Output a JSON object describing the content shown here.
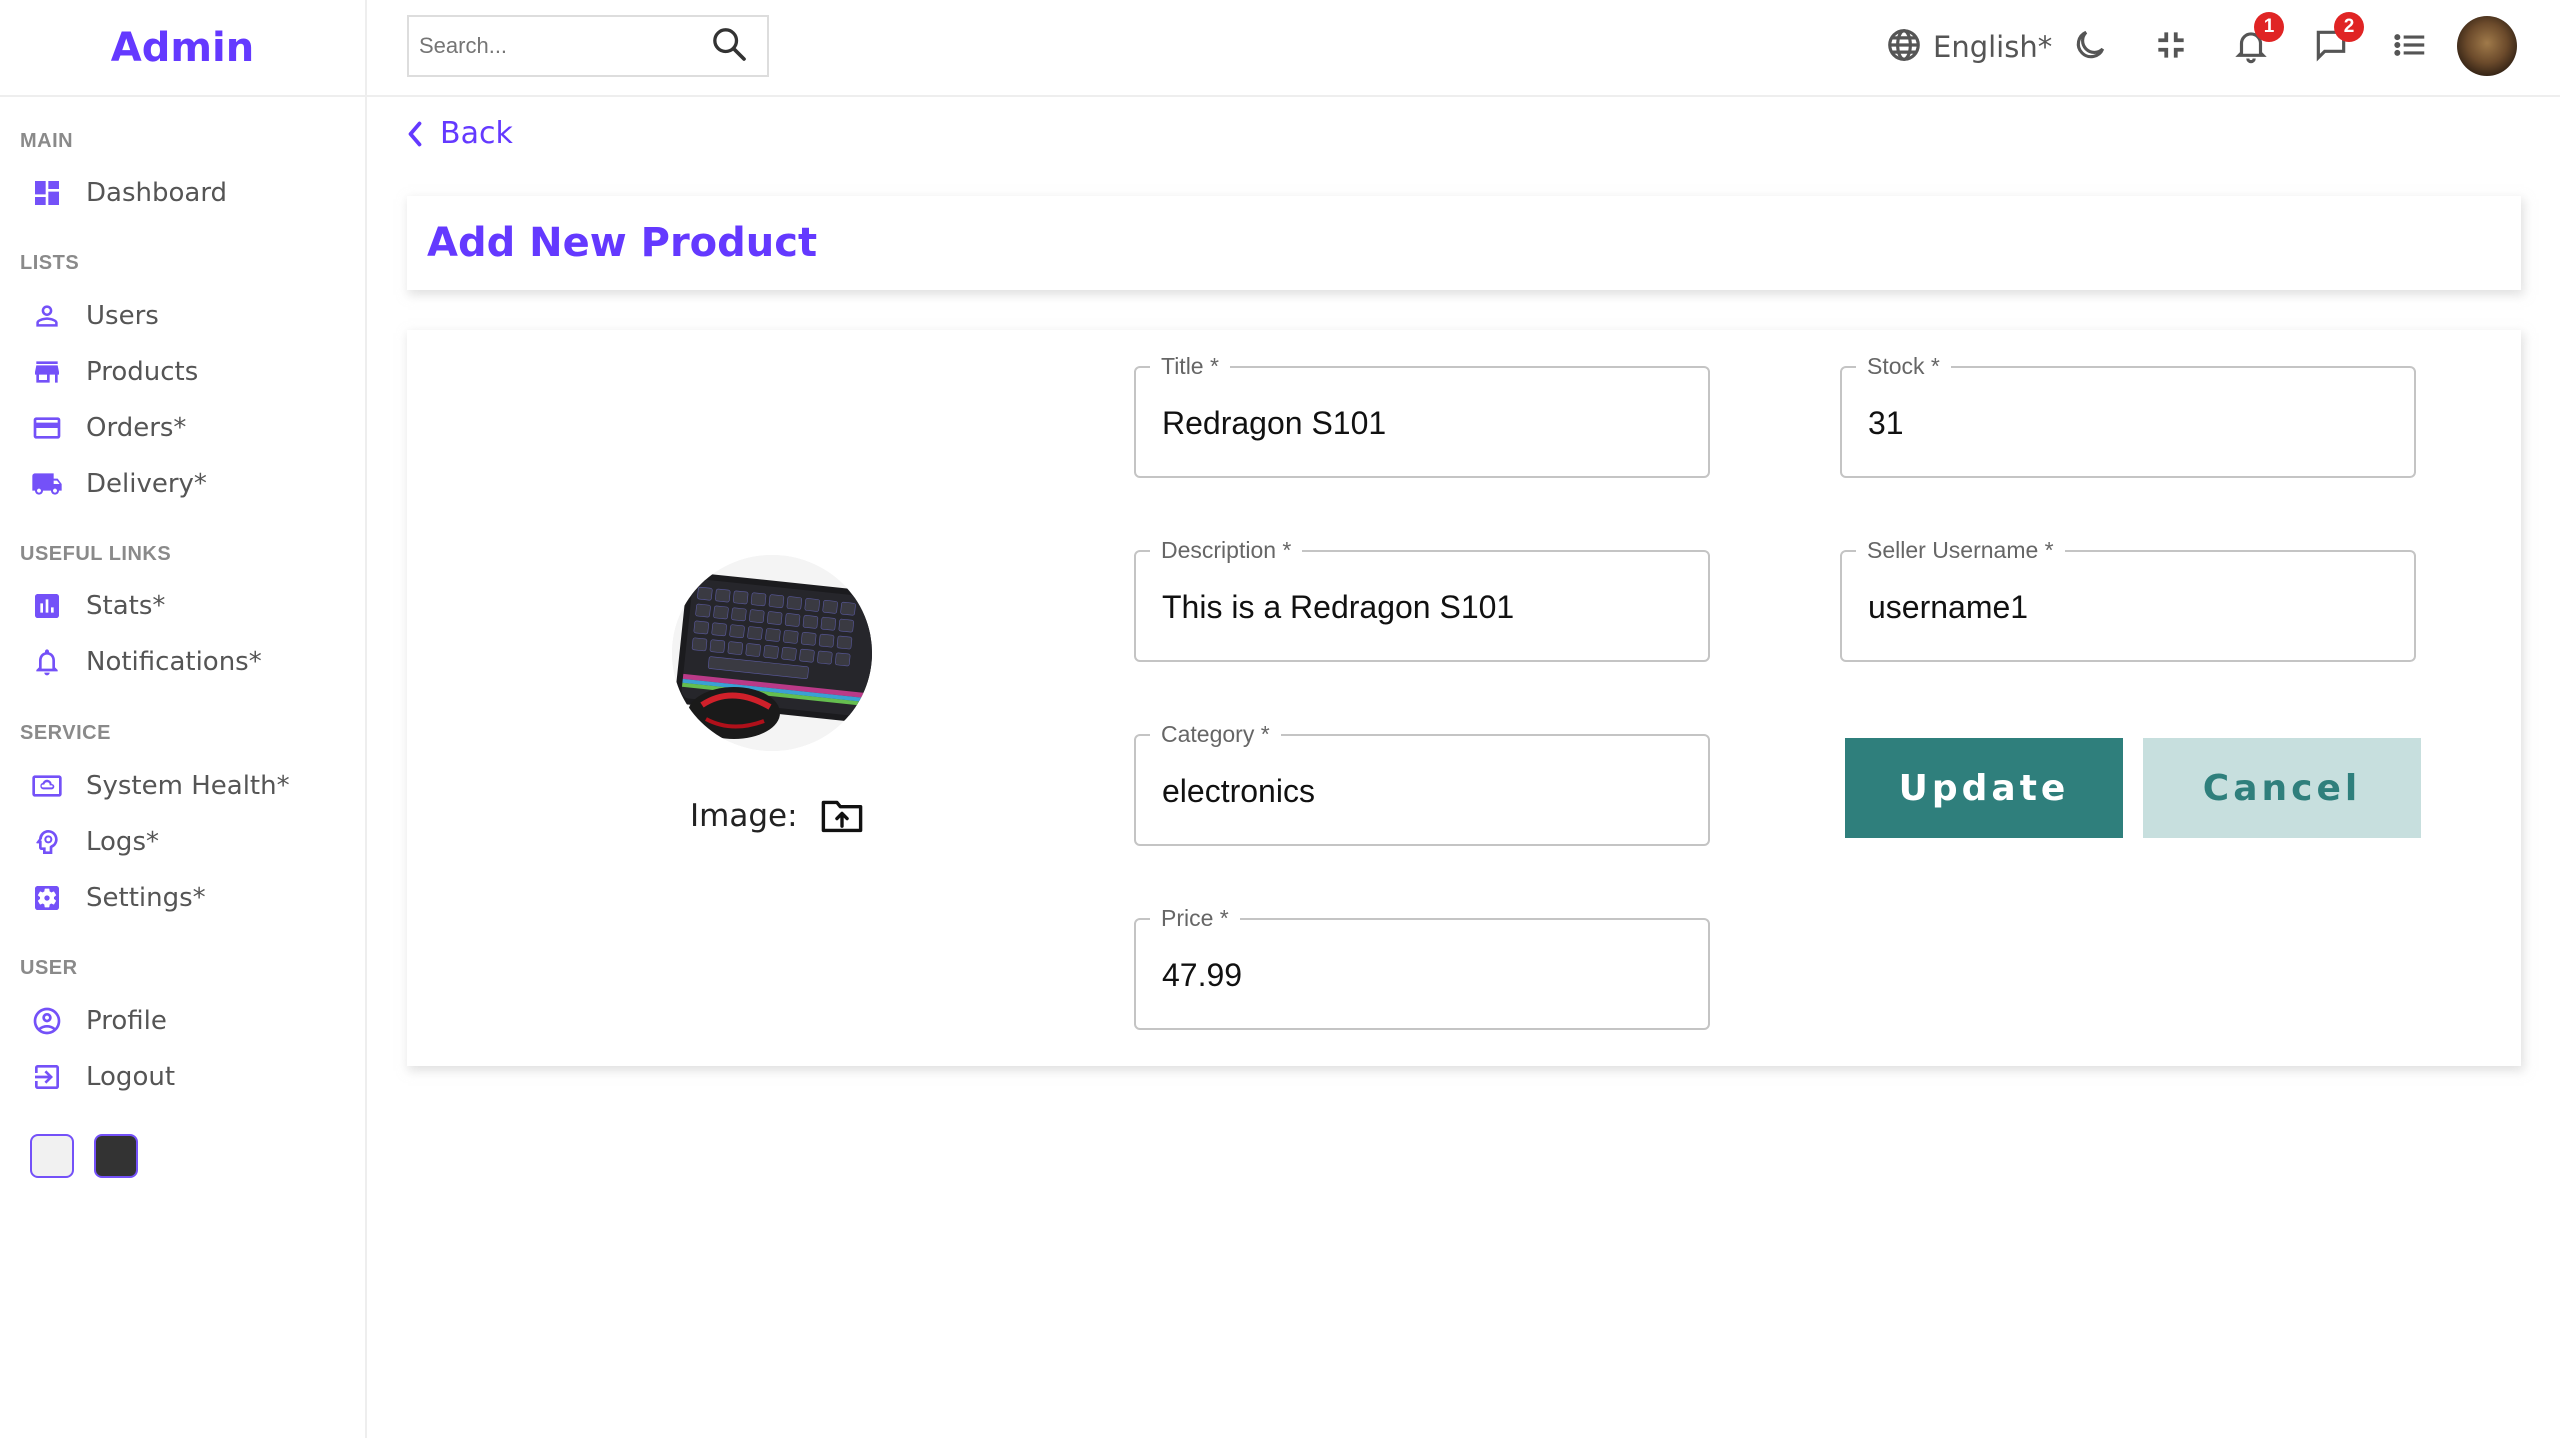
{
  "app": {
    "title": "Admin"
  },
  "sidebar": {
    "sections": {
      "main": "MAIN",
      "lists": "LISTS",
      "useful_links": "USEFUL LINKS",
      "service": "SERVICE",
      "user": "USER"
    },
    "items": [
      {
        "label": "Dashboard",
        "icon": "dashboard-icon"
      },
      {
        "label": "Users",
        "icon": "user-icon"
      },
      {
        "label": "Products",
        "icon": "store-icon"
      },
      {
        "label": "Orders*",
        "icon": "credit-card-icon"
      },
      {
        "label": "Delivery*",
        "icon": "truck-icon"
      },
      {
        "label": "Stats*",
        "icon": "chart-icon"
      },
      {
        "label": "Notifications*",
        "icon": "bell-icon"
      },
      {
        "label": "System Health*",
        "icon": "cloud-icon"
      },
      {
        "label": "Logs*",
        "icon": "brain-icon"
      },
      {
        "label": "Settings*",
        "icon": "settings-icon"
      },
      {
        "label": "Profile",
        "icon": "account-circle-icon"
      },
      {
        "label": "Logout",
        "icon": "logout-icon"
      }
    ],
    "theme_swatches": [
      {
        "name": "light",
        "color": "#f1f1f1"
      },
      {
        "name": "dark",
        "color": "#333333"
      }
    ]
  },
  "topbar": {
    "search": {
      "placeholder": "Search...",
      "value": ""
    },
    "language": "English*",
    "notifications_count": "1",
    "messages_count": "2"
  },
  "main": {
    "back_label": "Back",
    "page_title": "Add New Product",
    "image_label": "Image:",
    "fields": {
      "title": {
        "label": "Title *",
        "value": "Redragon S101"
      },
      "description": {
        "label": "Description *",
        "value": "This is a Redragon S101"
      },
      "category": {
        "label": "Category *",
        "value": "electronics"
      },
      "price": {
        "label": "Price *",
        "value": "47.99"
      },
      "stock": {
        "label": "Stock *",
        "value": "31"
      },
      "seller": {
        "label": "Seller Username *",
        "value": "username1"
      }
    },
    "buttons": {
      "update": "Update",
      "cancel": "Cancel"
    }
  },
  "colors": {
    "accent": "#6439ff",
    "icon_purple": "#7451f8",
    "teal": "#2f7f7c",
    "teal_light": "#c7dfde",
    "badge_red": "#e02424"
  }
}
